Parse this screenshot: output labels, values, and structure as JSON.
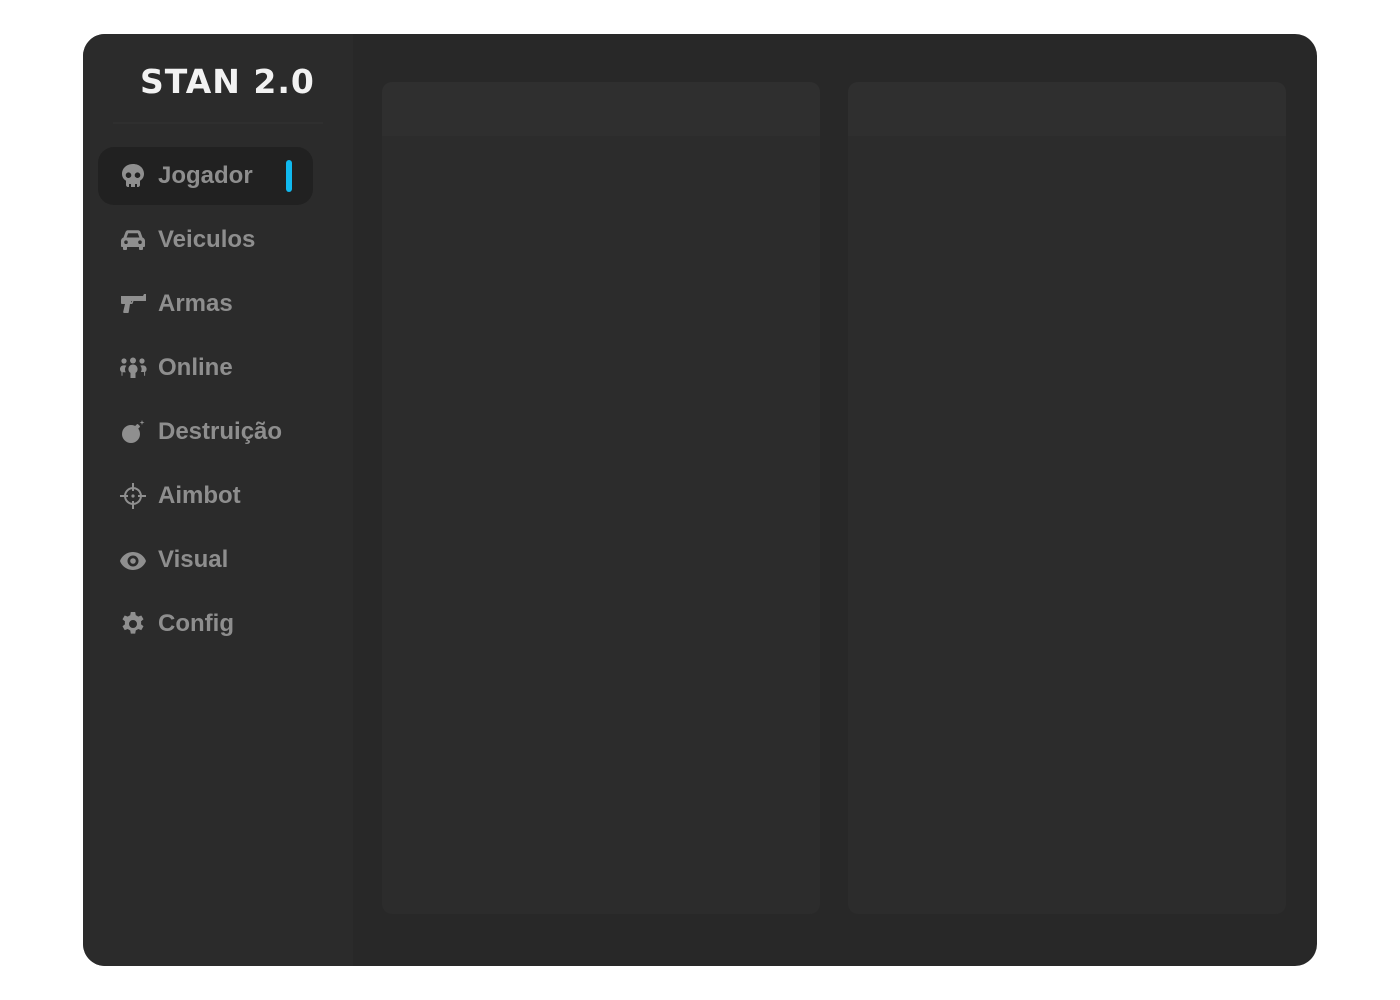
{
  "app": {
    "title": "STAN 2.0"
  },
  "colors": {
    "accent": "#10b9ef",
    "window_bg": "#282828",
    "sidebar_bg": "#2b2b2b",
    "panel_bg": "#2c2c2c",
    "text_muted": "#8e8e8e",
    "logo_text": "#f2f2f2"
  },
  "sidebar": {
    "items": [
      {
        "label": "Jogador",
        "icon": "skull-icon",
        "active": true
      },
      {
        "label": "Veiculos",
        "icon": "car-icon",
        "active": false
      },
      {
        "label": "Armas",
        "icon": "gun-icon",
        "active": false
      },
      {
        "label": "Online",
        "icon": "people-group-icon",
        "active": false
      },
      {
        "label": "Destruição",
        "icon": "bomb-icon",
        "active": false
      },
      {
        "label": "Aimbot",
        "icon": "crosshairs-icon",
        "active": false
      },
      {
        "label": "Visual",
        "icon": "eye-icon",
        "active": false
      },
      {
        "label": "Config",
        "icon": "gear-icon",
        "active": false
      }
    ]
  }
}
